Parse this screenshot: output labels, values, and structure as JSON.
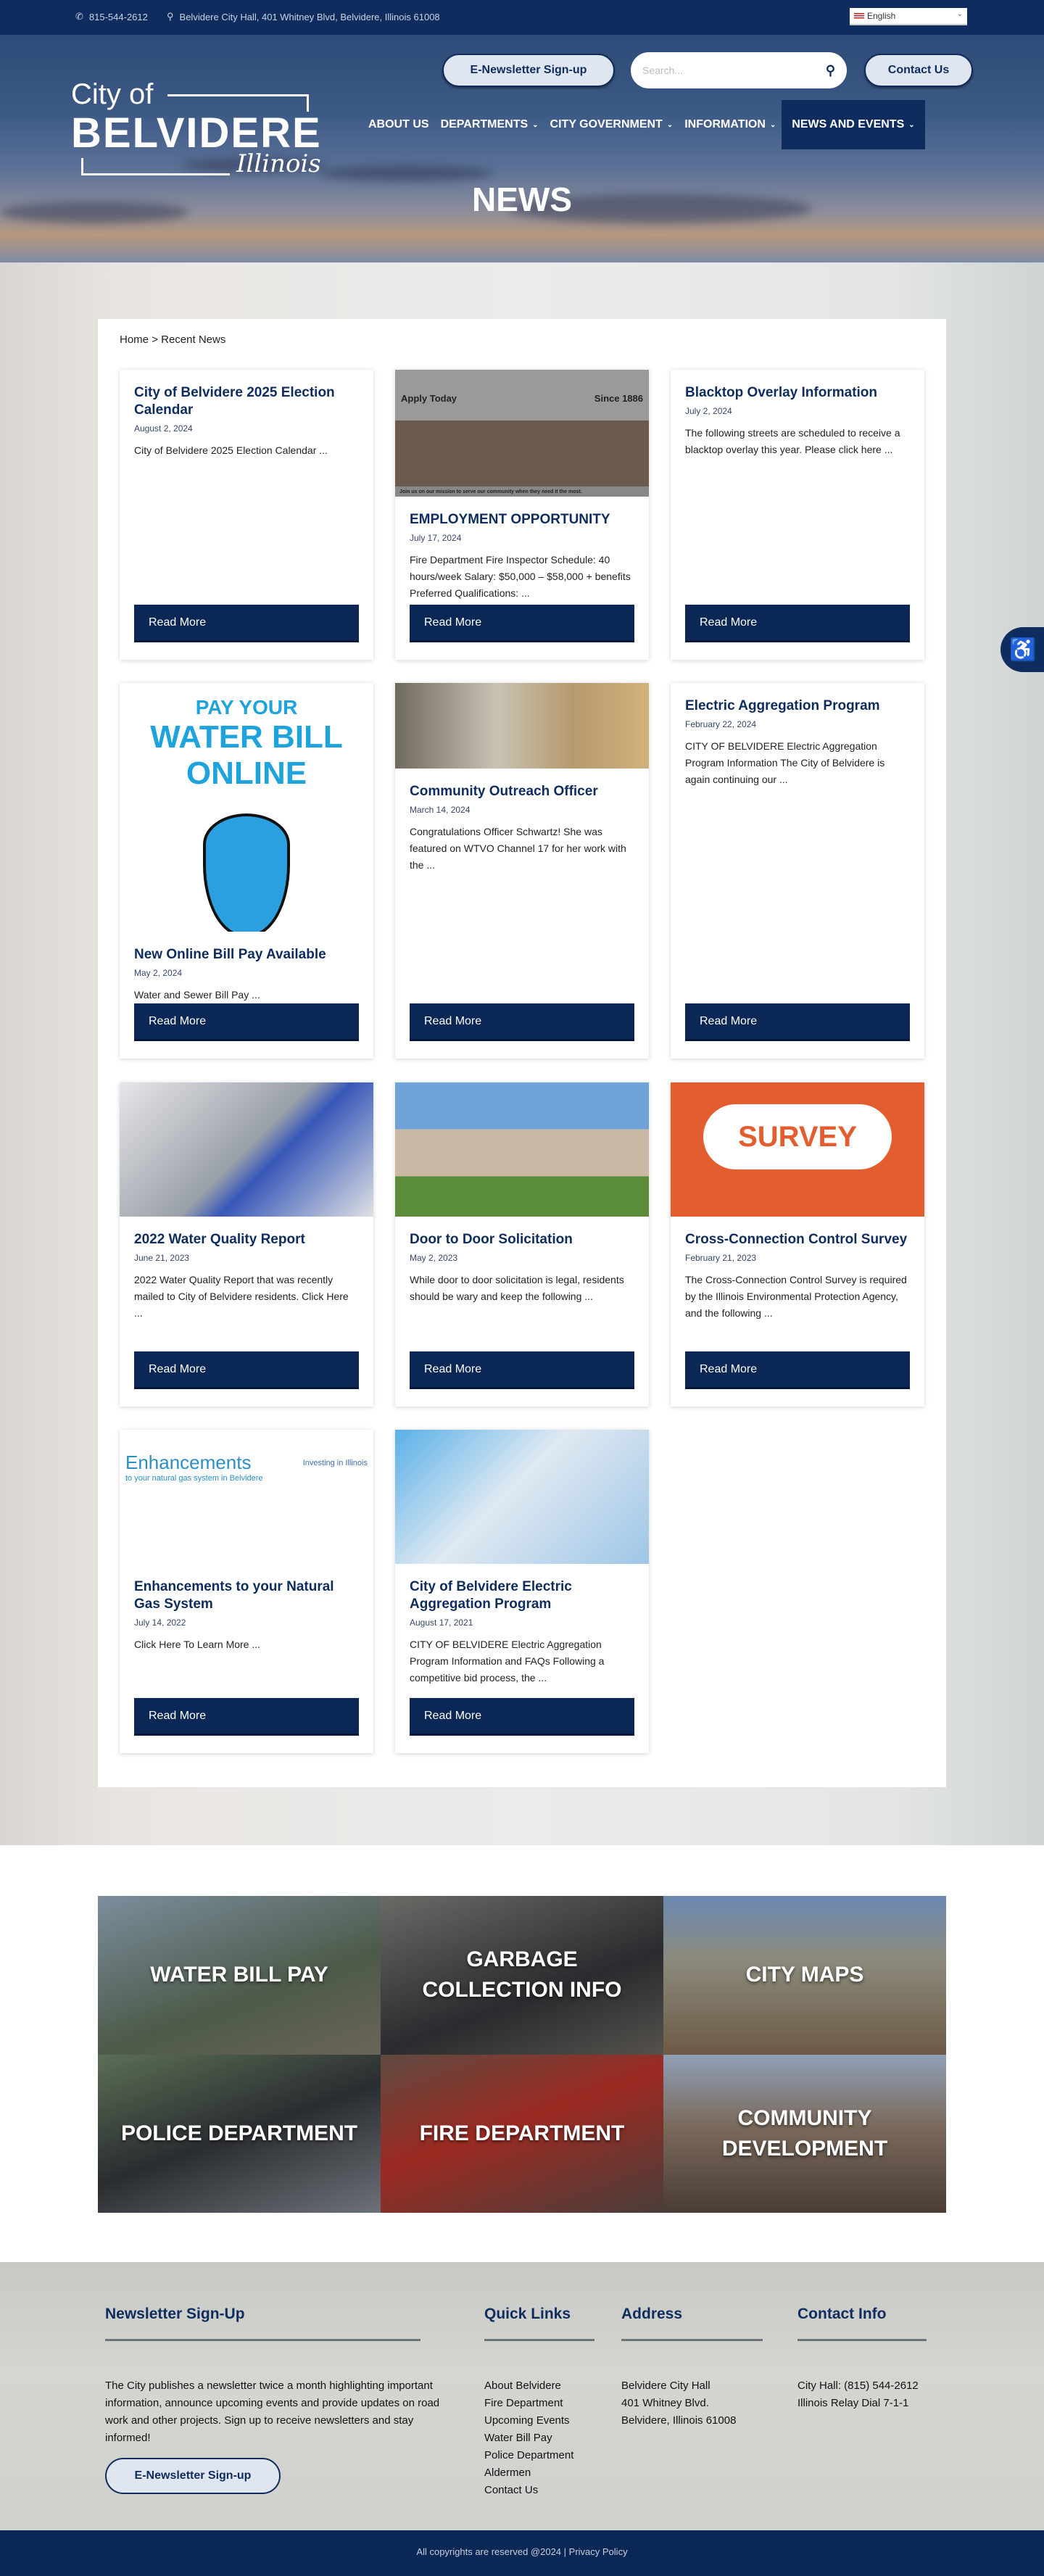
{
  "topbar": {
    "phone": "815-544-2612",
    "address": "Belvidere City Hall, 401 Whitney Blvd, Belvidere, Illinois 61008",
    "language": "English"
  },
  "logo": {
    "line1": "City of",
    "line2": "BELVIDERE",
    "line3": "Illinois"
  },
  "header": {
    "newsletter_label": "E-Newsletter Sign-up",
    "search_placeholder": "Search...",
    "contact_label": "Contact Us"
  },
  "nav": [
    {
      "label": "ABOUT US",
      "dropdown": false
    },
    {
      "label": "DEPARTMENTS",
      "dropdown": true
    },
    {
      "label": "CITY GOVERNMENT",
      "dropdown": true
    },
    {
      "label": "INFORMATION",
      "dropdown": true
    },
    {
      "label": "NEWS AND EVENTS",
      "dropdown": true,
      "active": true
    }
  ],
  "page_title": "NEWS",
  "breadcrumb": {
    "home": "Home",
    "separator": ">",
    "current": "Recent News"
  },
  "read_more_label": "Read More",
  "cards": [
    {
      "title": "City of Belvidere 2025 Election Calendar",
      "date": "August 2, 2024",
      "excerpt": "City of Belvidere 2025 Election Calendar ...",
      "image": null
    },
    {
      "title": "EMPLOYMENT OPPORTUNITY",
      "date": "July 17, 2024",
      "excerpt": "Fire Department  Fire Inspector Schedule: 40 hours/week  Salary: $50,000 – $58,000 + benefits  Preferred Qualifications: ...",
      "image": "fire-department-banner",
      "image_text": [
        "Apply Today",
        "Since 1886",
        "Join us on our mission to serve our community when they need it the most."
      ]
    },
    {
      "title": "Blacktop Overlay Information",
      "date": "July 2, 2024",
      "excerpt": "The following streets are scheduled to receive a blacktop overlay this year. Please click here ...",
      "image": null
    },
    {
      "title": "New Online Bill Pay Available",
      "date": "May 2, 2024",
      "excerpt": "Water and Sewer Bill Pay ...",
      "image": "water-bill-drop",
      "image_text": [
        "PAY YOUR",
        "WATER BILL ONLINE"
      ]
    },
    {
      "title": "Community Outreach Officer",
      "date": "March 14, 2024",
      "excerpt": "Congratulations Officer Schwartz! She was featured on WTVO Channel 17 for her work with the ...",
      "image": "classroom-photo"
    },
    {
      "title": "Electric Aggregation Program",
      "date": "February 22, 2024",
      "excerpt": "CITY OF BELVIDERE Electric Aggregation Program Information  The City of Belvidere is again continuing our ...",
      "image": null
    },
    {
      "title": "2022 Water Quality Report",
      "date": "June 21, 2023",
      "excerpt": "2022 Water Quality Report that was recently mailed to City of Belvidere residents. Click Here ...",
      "image": "water-test-tube-photo"
    },
    {
      "title": "Door to Door Solicitation",
      "date": "May 2, 2023",
      "excerpt": "While door to door solicitation is legal, residents should be wary and keep the following ...",
      "image": "house-photo"
    },
    {
      "title": "Cross-Connection Control Survey",
      "date": "February 21, 2023",
      "excerpt": "The Cross-Connection Control Survey is required by the Illinois Environmental Protection Agency, and the following ...",
      "image": "survey-bubble",
      "image_text": [
        "SURVEY"
      ]
    },
    {
      "title": "Enhancements to your Natural Gas System",
      "date": "July 14, 2022",
      "excerpt": "Click Here To Learn More ...",
      "image": "enhancements-flyer",
      "image_text": [
        "Enhancements",
        "to your natural gas system in Belvidere",
        "Investing in Illinois"
      ]
    },
    {
      "title": "City of Belvidere Electric Aggregation Program",
      "date": "August 17, 2021",
      "excerpt": "CITY OF BELVIDERE Electric Aggregation Program Information and FAQs Following a competitive bid process, the ...",
      "image": "calculator-bulb-photo"
    }
  ],
  "tiles": [
    {
      "label": "WATER BILL PAY"
    },
    {
      "label": "GARBAGE COLLECTION INFO"
    },
    {
      "label": "CITY MAPS"
    },
    {
      "label": "POLICE DEPARTMENT"
    },
    {
      "label": "FIRE DEPARTMENT"
    },
    {
      "label": "COMMUNITY DEVELOPMENT"
    }
  ],
  "footer": {
    "newsletter": {
      "heading": "Newsletter Sign-Up",
      "text": "The City publishes a newsletter twice a month highlighting important information, announce upcoming events and provide updates on road work and other projects. Sign up to receive newsletters and stay informed!",
      "button": "E-Newsletter Sign-up"
    },
    "quick_links": {
      "heading": "Quick Links",
      "items": [
        "About Belvidere",
        "Fire Department",
        "Upcoming Events",
        "Water Bill Pay",
        "Police Department",
        "Aldermen",
        "Contact Us"
      ]
    },
    "address": {
      "heading": "Address",
      "lines": [
        "Belvidere City Hall",
        "401 Whitney Blvd.",
        "Belvidere, Illinois 61008"
      ]
    },
    "contact": {
      "heading": "Contact Info",
      "lines": [
        "City Hall: (815) 544-2612",
        "Illinois Relay Dial 7-1-1"
      ]
    },
    "copyright": "All copyrights are reserved @2024",
    "privacy": "Privacy Policy"
  },
  "colors": {
    "navy": "#0e2d5e",
    "button": "#0a2755",
    "pill": "#dfe6ef"
  }
}
